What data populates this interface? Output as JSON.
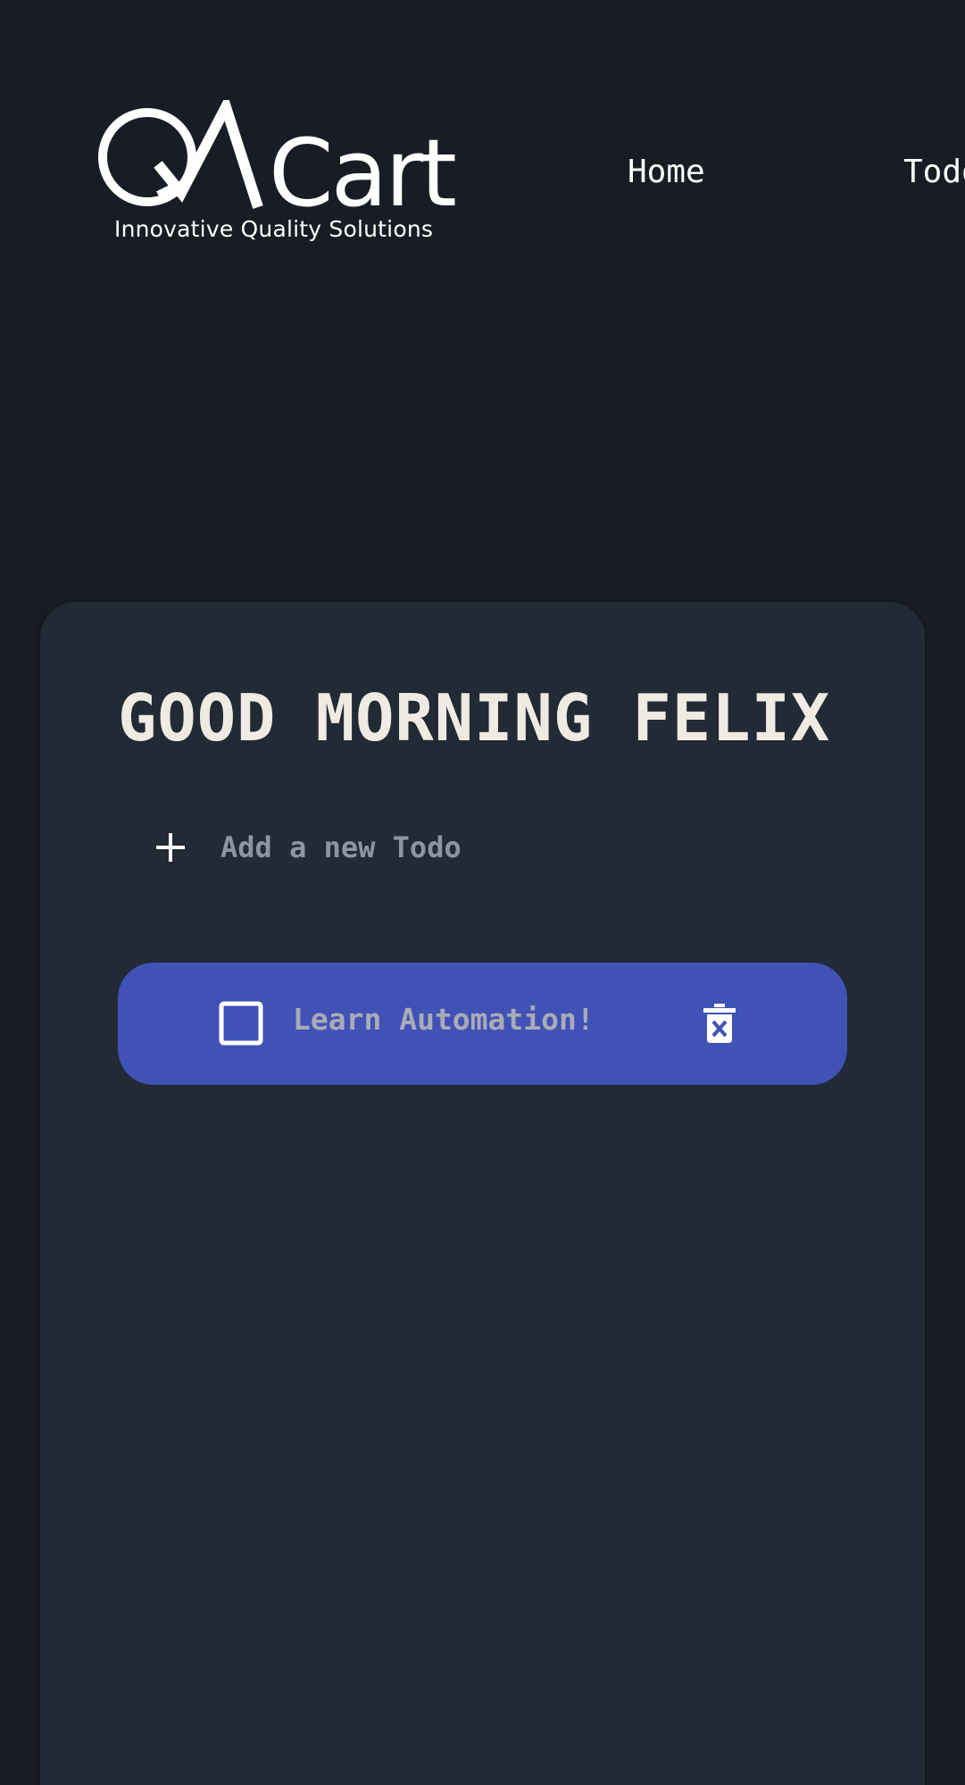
{
  "header": {
    "logo": {
      "brand": "QACart",
      "tagline": "Innovative Quality Solutions"
    },
    "nav": [
      {
        "label": "Home"
      },
      {
        "label": "Todo"
      }
    ]
  },
  "main": {
    "greeting": "GOOD MORNING FELIX",
    "add_todo": {
      "placeholder": "Add a new Todo",
      "value": "",
      "icon": "plus-icon"
    },
    "todos": [
      {
        "text": "Learn Automation!",
        "completed": false,
        "check_icon": "checkbox-icon",
        "delete_icon": "delete-icon"
      }
    ]
  },
  "colors": {
    "page_background": "#181d25",
    "card_background": "#212a35",
    "todo_item_background": "#4052b5",
    "greeting_text": "#efebe3",
    "placeholder_text": "#8b96a3",
    "todo_text": "#a9abb6"
  }
}
